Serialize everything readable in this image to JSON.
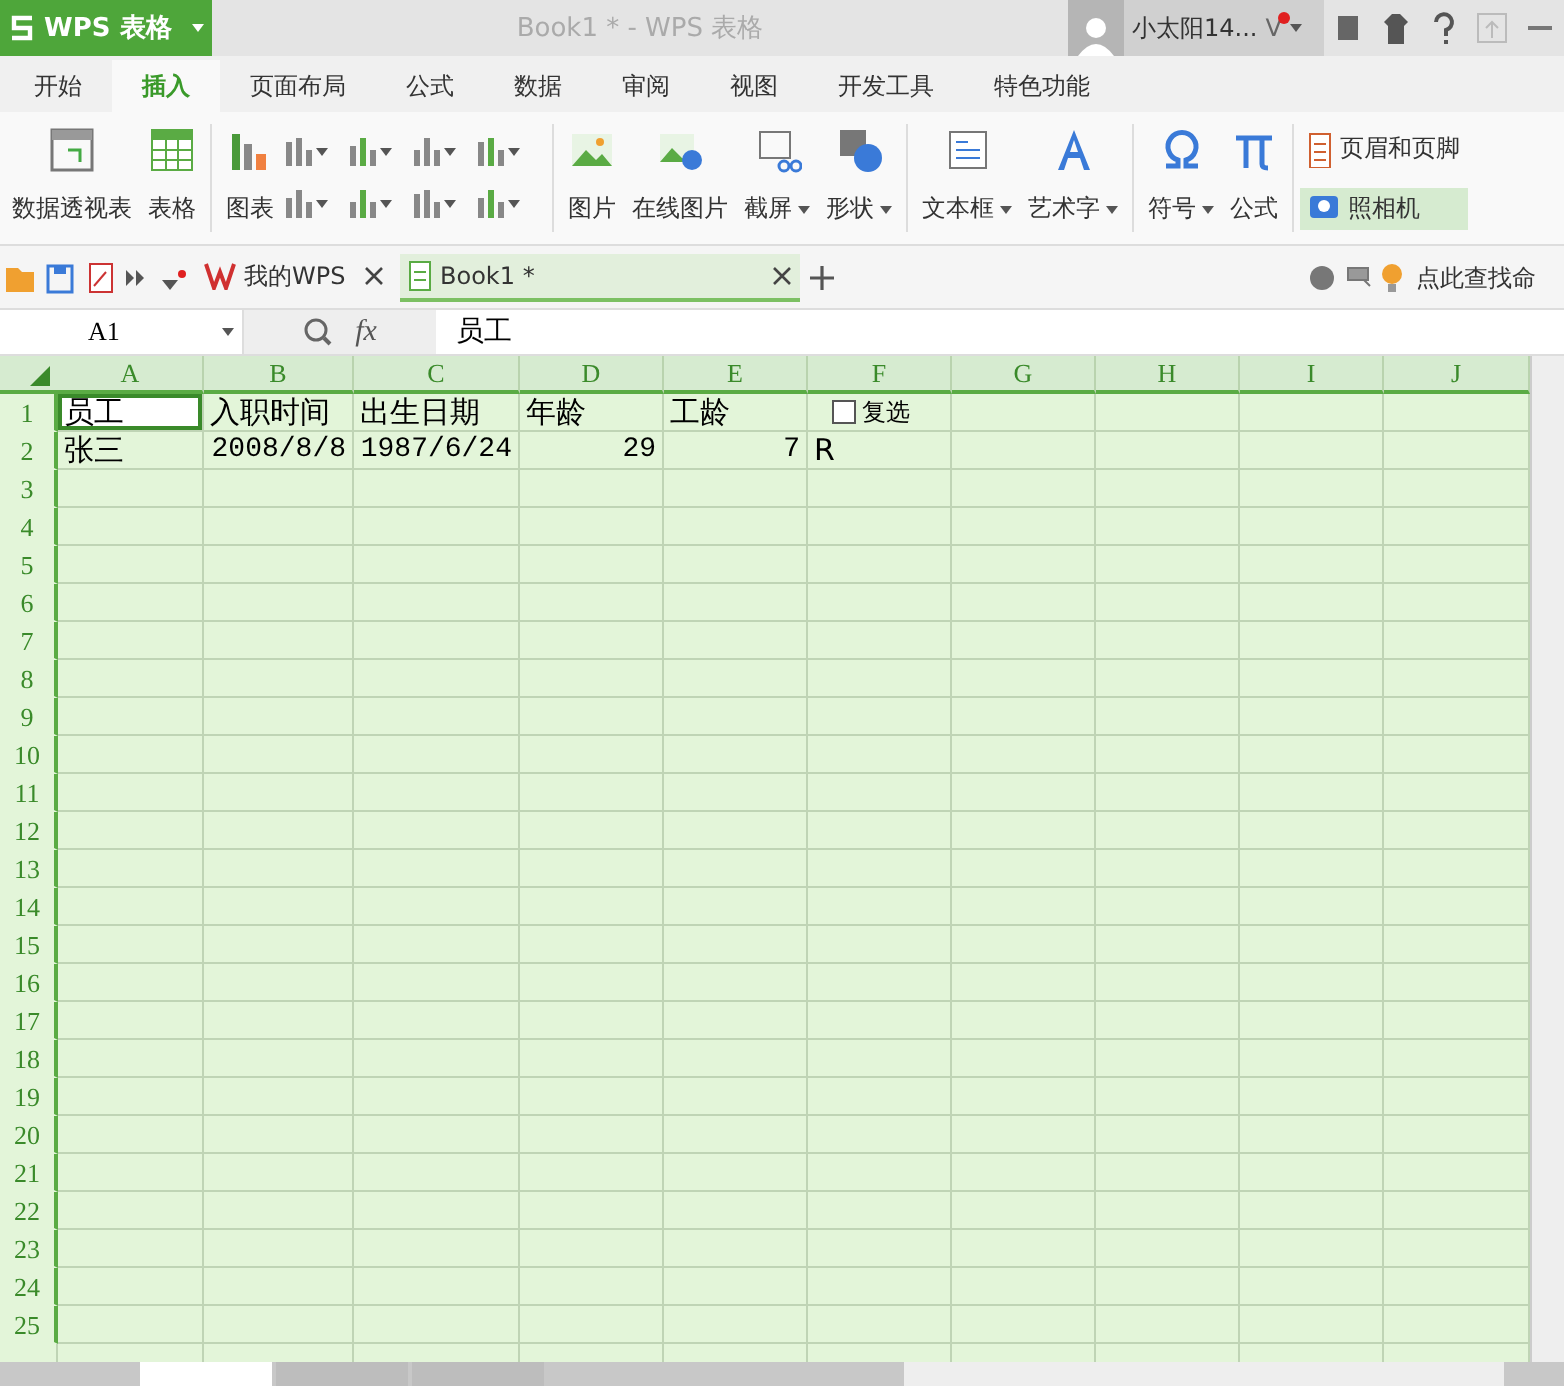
{
  "app_menu": {
    "label": "WPS 表格"
  },
  "window": {
    "title": "Book1 * - WPS 表格"
  },
  "user": {
    "name": "小太阳14...",
    "badge": "V",
    "notification": true
  },
  "menu_tabs": [
    {
      "label": "开始",
      "selected": false
    },
    {
      "label": "插入",
      "selected": true
    },
    {
      "label": "页面布局",
      "selected": false
    },
    {
      "label": "公式",
      "selected": false
    },
    {
      "label": "数据",
      "selected": false
    },
    {
      "label": "审阅",
      "selected": false
    },
    {
      "label": "视图",
      "selected": false
    },
    {
      "label": "开发工具",
      "selected": false
    },
    {
      "label": "特色功能",
      "selected": false
    }
  ],
  "ribbon": [
    {
      "kind": "big",
      "label": "数据透视表",
      "dropdown": false
    },
    {
      "kind": "big",
      "label": "表格",
      "dropdown": false
    },
    {
      "kind": "sep"
    },
    {
      "kind": "big",
      "label": "图表",
      "dropdown": false
    },
    {
      "kind": "chartgrid"
    },
    {
      "kind": "sep"
    },
    {
      "kind": "big",
      "label": "图片",
      "dropdown": false
    },
    {
      "kind": "big",
      "label": "在线图片",
      "dropdown": false
    },
    {
      "kind": "big",
      "label": "截屏",
      "dropdown": true
    },
    {
      "kind": "big",
      "label": "形状",
      "dropdown": true
    },
    {
      "kind": "sep"
    },
    {
      "kind": "big",
      "label": "文本框",
      "dropdown": true
    },
    {
      "kind": "big",
      "label": "艺术字",
      "dropdown": true
    },
    {
      "kind": "sep"
    },
    {
      "kind": "big",
      "label": "符号",
      "dropdown": true
    },
    {
      "kind": "big",
      "label": "公式",
      "dropdown": false
    },
    {
      "kind": "sep"
    },
    {
      "kind": "stack",
      "items": [
        {
          "label": "页眉和页脚",
          "selected": false
        },
        {
          "label": "照相机",
          "selected": true
        }
      ]
    }
  ],
  "doc_tabs": [
    {
      "label": "我的WPS",
      "kind": "home",
      "selected": false
    },
    {
      "label": "Book1 *",
      "kind": "book",
      "selected": true
    }
  ],
  "command_search": {
    "placeholder": "点此查找命"
  },
  "formula_bar": {
    "cell": "A1",
    "fx": "fx",
    "value": "员工"
  },
  "columns": [
    "A",
    "B",
    "C",
    "D",
    "E",
    "F",
    "G",
    "H",
    "I",
    "J"
  ],
  "rows": [
    {
      "label": "1",
      "cells": [
        {
          "kind": "text",
          "text": "员工",
          "selected": true
        },
        {
          "kind": "text",
          "text": "入职时间",
          "selected": false
        },
        {
          "kind": "text",
          "text": "出生日期",
          "selected": false
        },
        {
          "kind": "text",
          "text": "年龄",
          "selected": false
        },
        {
          "kind": "text",
          "text": "工龄",
          "selected": false
        },
        {
          "kind": "checkbox",
          "text": "复选",
          "checked": false,
          "selected": false
        }
      ]
    },
    {
      "label": "2",
      "cells": [
        {
          "kind": "text",
          "text": "张三",
          "selected": false
        },
        {
          "kind": "number",
          "text": "2008/8/8",
          "selected": false
        },
        {
          "kind": "number",
          "text": "1987/6/24",
          "selected": false
        },
        {
          "kind": "number",
          "text": "29",
          "selected": false
        },
        {
          "kind": "number",
          "text": "7",
          "selected": false
        },
        {
          "kind": "text",
          "text": "R",
          "selected": false
        }
      ]
    },
    {
      "label": "3",
      "cells": []
    },
    {
      "label": "4",
      "cells": []
    },
    {
      "label": "5",
      "cells": []
    },
    {
      "label": "6",
      "cells": []
    },
    {
      "label": "7",
      "cells": []
    },
    {
      "label": "8",
      "cells": []
    },
    {
      "label": "9",
      "cells": []
    },
    {
      "label": "10",
      "cells": []
    },
    {
      "label": "11",
      "cells": []
    },
    {
      "label": "12",
      "cells": []
    },
    {
      "label": "13",
      "cells": []
    },
    {
      "label": "14",
      "cells": []
    },
    {
      "label": "15",
      "cells": []
    },
    {
      "label": "16",
      "cells": []
    },
    {
      "label": "17",
      "cells": []
    },
    {
      "label": "18",
      "cells": []
    },
    {
      "label": "19",
      "cells": []
    },
    {
      "label": "20",
      "cells": []
    },
    {
      "label": "21",
      "cells": []
    },
    {
      "label": "22",
      "cells": []
    },
    {
      "label": "23",
      "cells": []
    },
    {
      "label": "24",
      "cells": []
    },
    {
      "label": "25",
      "cells": []
    }
  ],
  "sheet_tabs": [
    {
      "selected": true
    },
    {
      "selected": false
    },
    {
      "selected": false
    }
  ]
}
